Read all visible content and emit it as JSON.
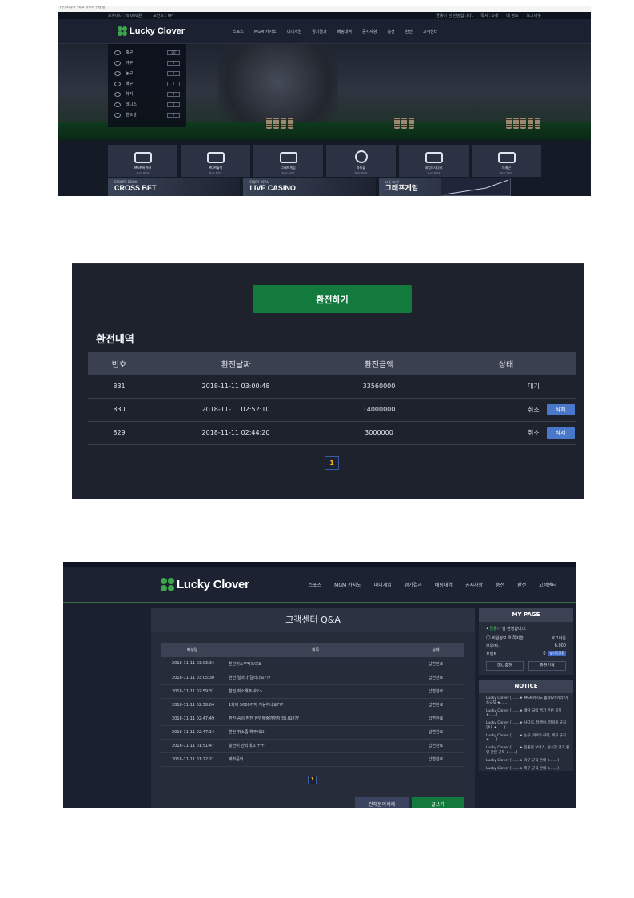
{
  "panel1": {
    "top_strip": "(주) 피니아 - 외 2 사이트 구경 중",
    "util_left": [
      "보유머니 : 6,000원",
      "포인트 : 0P"
    ],
    "util_right": [
      "금동이 님 환영합니다.",
      "쪽지 : 0개",
      "내 정보",
      "로그아웃"
    ],
    "logo": "Lucky Clover",
    "menu": [
      "스포츠",
      "MGM 카지노",
      "미니게임",
      "경기결과",
      "배팅내역",
      "공지사항",
      "충전",
      "환전",
      "고객센터"
    ],
    "sports": [
      {
        "label": "축구",
        "count": "00"
      },
      {
        "label": "야구",
        "count": "0"
      },
      {
        "label": "농구",
        "count": "0"
      },
      {
        "label": "배구",
        "count": "0"
      },
      {
        "label": "하키",
        "count": "0"
      },
      {
        "label": "테니스",
        "count": "0"
      },
      {
        "label": "핸드볼",
        "count": "0"
      }
    ],
    "games": [
      {
        "label": "MGM바카라",
        "play": "PLAY NOW"
      },
      {
        "label": "MGM홀짝",
        "play": "PLAY NOW"
      },
      {
        "label": "그래프게임",
        "play": "PLAY NOW"
      },
      {
        "label": "파워볼",
        "play": "PLAY NOW"
      },
      {
        "label": "네임드사다리",
        "play": "PLAY NOW"
      },
      {
        "label": "드래곤",
        "play": "PLAY NOW"
      }
    ],
    "banners": [
      {
        "top": "SPORTS BOOK",
        "big": "CROSS BET"
      },
      {
        "top": "ENJOY REAL",
        "big": "LIVE CASINO"
      },
      {
        "top": "요즘 대세!",
        "big": "그래프게임"
      }
    ]
  },
  "panel2": {
    "button": "환전하기",
    "title": "환전내역",
    "headers": [
      "번호",
      "환전날짜",
      "환전금액",
      "상태"
    ],
    "rows": [
      {
        "no": "831",
        "date": "2018-11-11 03:00:48",
        "amount": "33560000",
        "status": "대기",
        "action": ""
      },
      {
        "no": "830",
        "date": "2018-11-11 02:52:10",
        "amount": "14000000",
        "status": "취소",
        "action": "삭제"
      },
      {
        "no": "829",
        "date": "2018-11-11 02:44:20",
        "amount": "3000000",
        "status": "취소",
        "action": "삭제"
      }
    ],
    "page": "1"
  },
  "panel3": {
    "logo": "Lucky Clover",
    "menu": [
      "스포츠",
      "MGM 카지노",
      "미니게임",
      "경기결과",
      "배팅내역",
      "공지사항",
      "충전",
      "환전",
      "고객센터"
    ],
    "title": "고객센터 Q&A",
    "headers": [
      "작성일",
      "제목",
      "상태"
    ],
    "rows": [
      {
        "date": "2018-11-11 03:03:34",
        "title": "환전취소부탁드려요",
        "status": "답변완료"
      },
      {
        "date": "2018-11-11 03:05:30",
        "title": "환전 얼마나 걸리나요???",
        "status": "답변완료"
      },
      {
        "date": "2018-11-11 02:59:31",
        "title": "환전 취소해주세요~",
        "status": "답변완료"
      },
      {
        "date": "2018-11-11 02:58:04",
        "title": "1회에 5000까지 가능하나요???",
        "status": "답변완료"
      },
      {
        "date": "2018-11-11 02:47:49",
        "title": "환전 중의 환전 한번해줄까까지 되나요???",
        "status": "답변완료"
      },
      {
        "date": "2018-11-11 02:47:14",
        "title": "환전 취소좀 해주세요",
        "status": "답변완료"
      },
      {
        "date": "2018-11-11 01:51:47",
        "title": "충전이 안되네요 ㅜㅜ",
        "status": "답변완료"
      },
      {
        "date": "2018-11-11 01:22:21",
        "title": "계좌문의",
        "status": "답변완료"
      }
    ],
    "page": "1",
    "btn_delete_all": "전체문의삭제",
    "btn_write": "글쓰기",
    "mypage": {
      "title": "MY PAGE",
      "welcome_name": "금동이",
      "welcome_rest": " 님 환영합니다.",
      "info": "회원정보",
      "note": "쪽지함",
      "logout": "로그아웃",
      "money_label": "보유머니",
      "money": "6,000",
      "point_label": "포인트",
      "point": "0",
      "point_btn": "포인트전환",
      "btn_charge": "머니충전",
      "btn_exchange": "환전신청"
    },
    "notice": {
      "title": "NOTICE",
      "items": [
        "Lucky Clover [ ......★ MGM카지노 홀짝&바카라 이용규칙 ★......]",
        "Lucky Clover [ ......★ 배당 급락 경기 관련 공지 ★......]",
        "Lucky Clover [ ......★ 사다리, 달팽이, 파워볼 규칙 안내 ★......]",
        "Lucky Clover [ ......★ 농구, 아이스하키, 배구 규칙 ★......]",
        "Lucky Clover [ ......★ 진출전 보너스, 실시간 경기 롤링 관련 규칙 ★......]",
        "Lucky Clover [ ......★ 야구 규칙 안내 ★......]",
        "Lucky Clover [ ......★ 축구 규칙 안내 ★......]"
      ]
    }
  }
}
